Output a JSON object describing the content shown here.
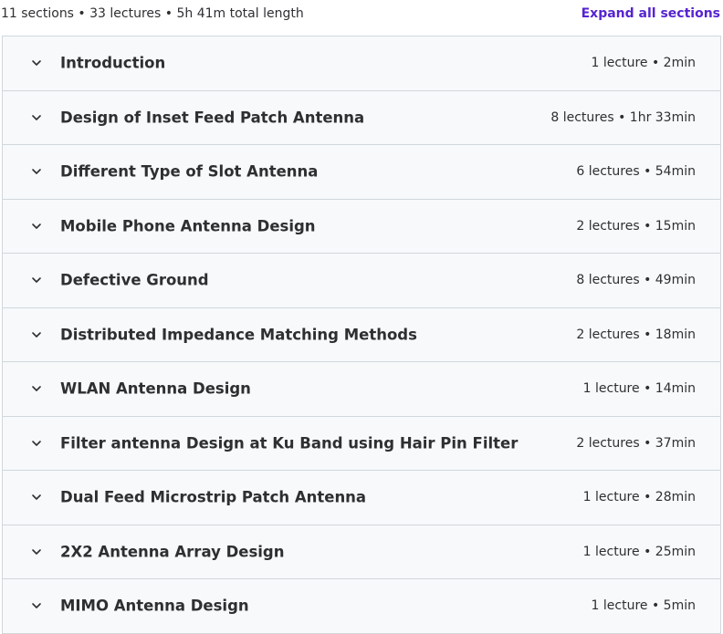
{
  "header": {
    "summary": "11 sections • 33 lectures • 5h 41m total length",
    "expand_label": "Expand all sections"
  },
  "sections": [
    {
      "title": "Introduction",
      "meta": "1 lecture • 2min"
    },
    {
      "title": "Design of Inset Feed Patch Antenna",
      "meta": "8 lectures • 1hr 33min"
    },
    {
      "title": "Different Type of Slot Antenna",
      "meta": "6 lectures • 54min"
    },
    {
      "title": "Mobile Phone Antenna Design",
      "meta": "2 lectures • 15min"
    },
    {
      "title": "Defective Ground",
      "meta": "8 lectures • 49min"
    },
    {
      "title": "Distributed Impedance Matching Methods",
      "meta": "2 lectures • 18min"
    },
    {
      "title": "WLAN Antenna Design",
      "meta": "1 lecture • 14min"
    },
    {
      "title": "Filter antenna Design at Ku Band using Hair Pin Filter",
      "meta": "2 lectures • 37min"
    },
    {
      "title": "Dual Feed Microstrip Patch Antenna",
      "meta": "1 lecture • 28min"
    },
    {
      "title": "2X2 Antenna Array Design",
      "meta": "1 lecture • 25min"
    },
    {
      "title": "MIMO Antenna Design",
      "meta": "1 lecture • 5min"
    }
  ],
  "icons": {
    "chevron": "chevron-down-icon"
  },
  "colors": {
    "accent": "#5624d0",
    "text": "#2d2f31",
    "row_bg": "#f7f9fa",
    "border": "#d1d7dc"
  }
}
